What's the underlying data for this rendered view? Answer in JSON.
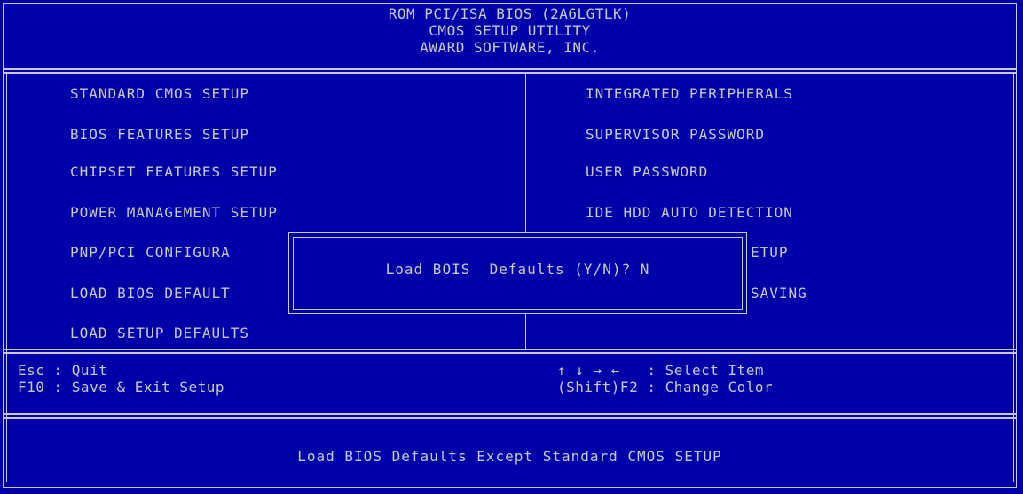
{
  "header": {
    "line1": "ROM PCI/ISA BIOS (2A6LGTLK)",
    "line2": "CMOS SETUP UTILITY",
    "line3": "AWARD SOFTWARE, INC."
  },
  "menu_left": [
    "STANDARD CMOS SETUP",
    "BIOS FEATURES SETUP",
    "CHIPSET FEATURES SETUP",
    "POWER MANAGEMENT SETUP",
    "PNP/PCI CONFIGURA",
    "LOAD BIOS DEFAULT",
    "LOAD SETUP DEFAULTS"
  ],
  "menu_right": [
    "INTEGRATED PERIPHERALS",
    "SUPERVISOR PASSWORD",
    "USER PASSWORD",
    "IDE HDD AUTO DETECTION",
    "ETUP",
    "SAVING"
  ],
  "hints": {
    "esc": "Esc : Quit",
    "f10": "F10 : Save & Exit Setup",
    "arrows": "↑ ↓ → ←   : Select Item",
    "shift_f2": "(Shift)F2 : Change Color"
  },
  "dialog": {
    "text": "Load BOIS  Defaults (Y/N)? N"
  },
  "status_bar": "Load BIOS Defaults Except Standard CMOS SETUP",
  "colors": {
    "background": "#0000a8",
    "foreground": "#c8c8c8"
  }
}
